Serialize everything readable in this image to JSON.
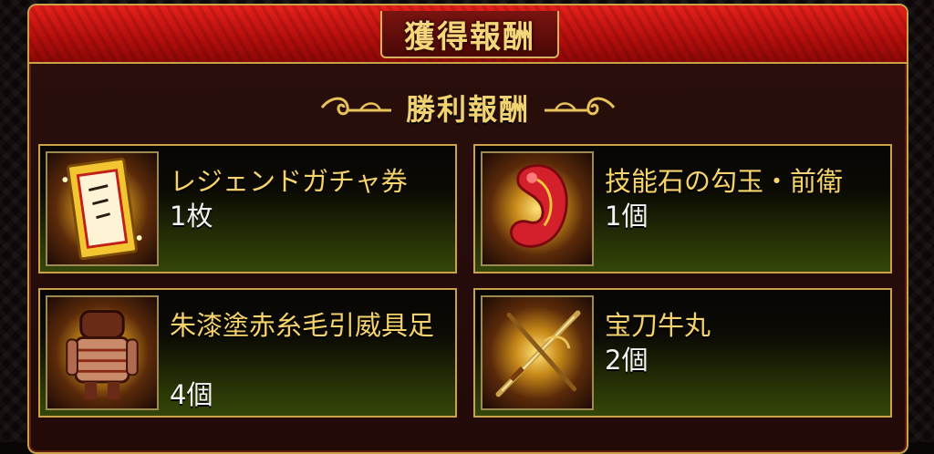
{
  "header": {
    "title": "獲得報酬"
  },
  "section": {
    "title": "勝利報酬"
  },
  "colors": {
    "accent_gold": "#f6d36c",
    "title_red": "#c8120e",
    "card_green": "#34460a"
  },
  "rewards": [
    {
      "name": "レジェンドガチャ券",
      "quantity": "1枚",
      "icon": "gacha-ticket-icon"
    },
    {
      "name": "技能石の勾玉・前衛",
      "quantity": "1個",
      "icon": "magatama-icon"
    },
    {
      "name": "朱漆塗赤糸毛引威具足",
      "quantity": "4個",
      "icon": "armor-icon"
    },
    {
      "name": "宝刀牛丸",
      "quantity": "2個",
      "icon": "sword-icon"
    }
  ]
}
